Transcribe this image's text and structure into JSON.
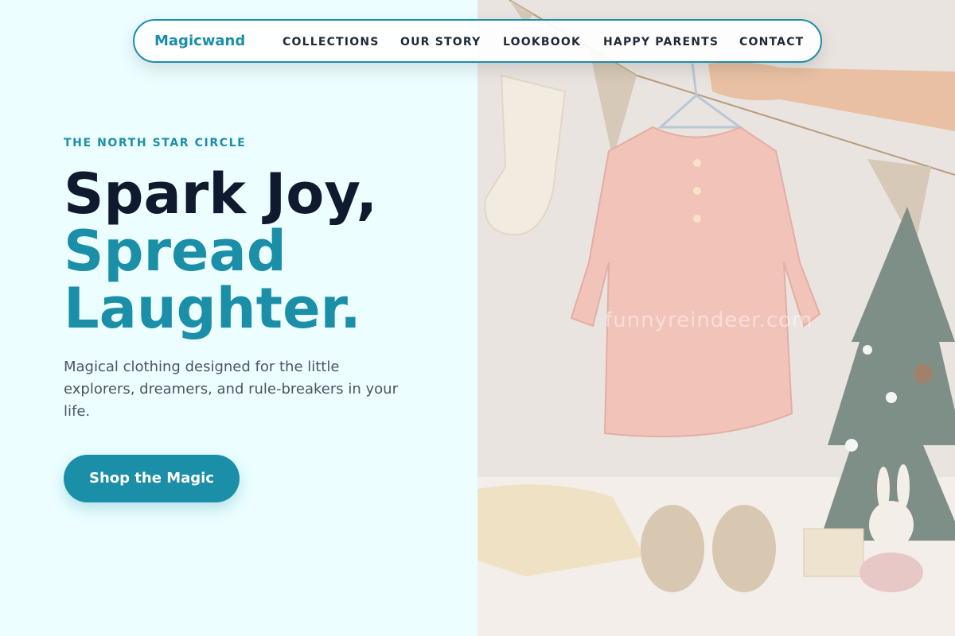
{
  "nav": {
    "brand": "Magicwand",
    "items": [
      "COLLECTIONS",
      "OUR STORY",
      "LOOKBOOK",
      "HAPPY PARENTS",
      "CONTACT"
    ]
  },
  "hero": {
    "eyebrow": "THE NORTH STAR CIRCLE",
    "headline_1": "Spark Joy,",
    "headline_2": "Spread",
    "headline_3": "Laughter.",
    "description": "Magical clothing designed for the little explorers, dreamers, and rule-breakers in your life.",
    "cta_label": "Shop the Magic"
  },
  "image": {
    "watermark": "funnyreindeer.com"
  },
  "colors": {
    "accent": "#1b8ea8",
    "heading": "#101a2e",
    "background": "#ecfeff"
  }
}
